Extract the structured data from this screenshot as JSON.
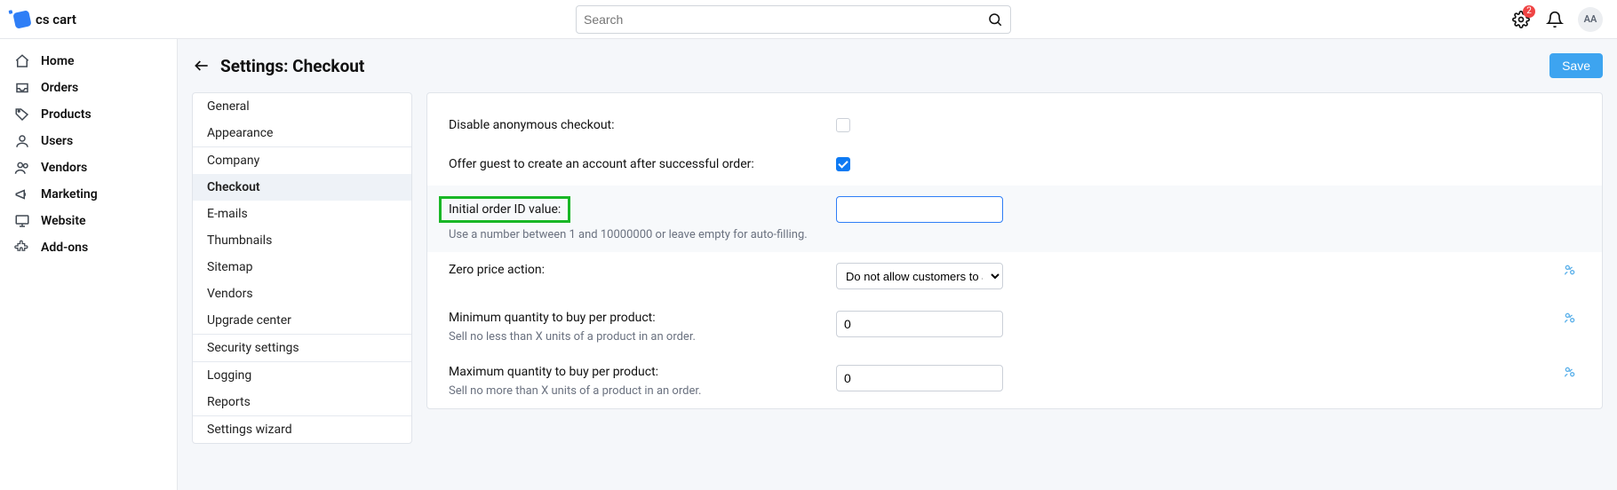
{
  "brand": "cs cart",
  "search": {
    "placeholder": "Search"
  },
  "topbar": {
    "gear_badge": "2",
    "avatar": "AA"
  },
  "nav": [
    {
      "label": "Home",
      "icon": "home"
    },
    {
      "label": "Orders",
      "icon": "inbox"
    },
    {
      "label": "Products",
      "icon": "tag"
    },
    {
      "label": "Users",
      "icon": "user"
    },
    {
      "label": "Vendors",
      "icon": "users"
    },
    {
      "label": "Marketing",
      "icon": "megaphone"
    },
    {
      "label": "Website",
      "icon": "monitor"
    },
    {
      "label": "Add-ons",
      "icon": "puzzle"
    }
  ],
  "page": {
    "title": "Settings: Checkout",
    "save_label": "Save"
  },
  "settings_nav_groups": [
    [
      "General",
      "Appearance"
    ],
    [
      "Company",
      "Checkout",
      "E-mails",
      "Thumbnails",
      "Sitemap",
      "Vendors",
      "Upgrade center"
    ],
    [
      "Security settings"
    ],
    [
      "Logging",
      "Reports"
    ],
    [
      "Settings wizard"
    ]
  ],
  "settings_active": "Checkout",
  "rows": {
    "disable_anon": {
      "label": "Disable anonymous checkout:",
      "checked": false
    },
    "offer_guest": {
      "label": "Offer guest to create an account after successful order:",
      "checked": true
    },
    "initial_order_id": {
      "label": "Initial order ID value:",
      "hint": "Use a number between 1 and 10000000 or leave empty for auto-filling.",
      "value": ""
    },
    "zero_price": {
      "label": "Zero price action:",
      "selected": "Do not allow customers to ad"
    },
    "min_qty": {
      "label": "Minimum quantity to buy per product:",
      "hint": "Sell no less than X units of a product in an order.",
      "value": "0"
    },
    "max_qty": {
      "label": "Maximum quantity to buy per product:",
      "hint": "Sell no more than X units of a product in an order.",
      "value": "0"
    }
  }
}
